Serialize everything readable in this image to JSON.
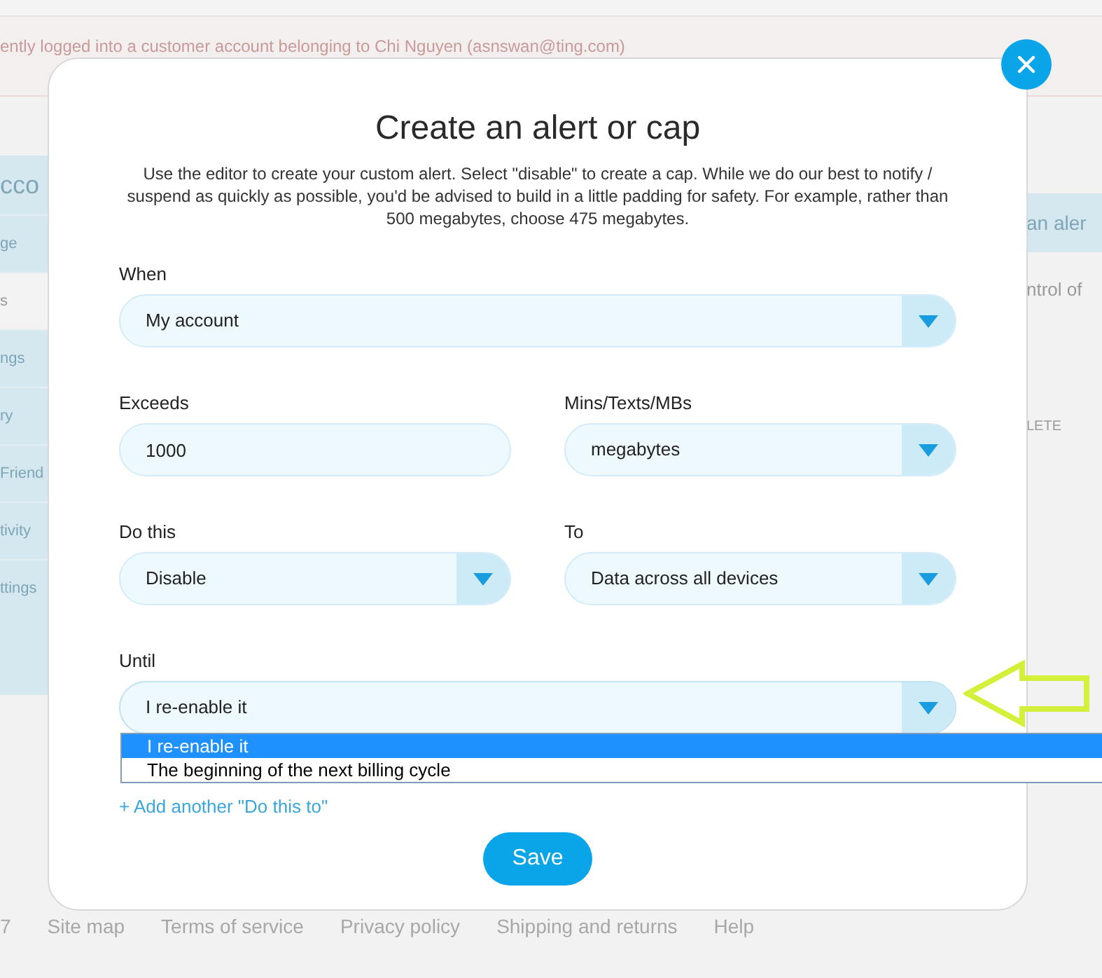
{
  "background": {
    "banner": "ently logged into a customer account belonging to Chi Nguyen (asnswan@ting.com)",
    "sidebar": {
      "heading": "cco",
      "items": [
        {
          "label": "ge",
          "selected": false
        },
        {
          "label": "s",
          "selected": true
        },
        {
          "label": "ngs",
          "selected": false
        },
        {
          "label": "ry",
          "selected": false
        },
        {
          "label": "Friend",
          "selected": false
        },
        {
          "label": "tivity",
          "selected": false
        },
        {
          "label": "ttings",
          "selected": false
        }
      ]
    },
    "right_panel": {
      "heading": "an aler",
      "text": "ntrol of",
      "column": "LETE"
    },
    "footer": [
      "7",
      "Site map",
      "Terms of service",
      "Privacy policy",
      "Shipping and returns",
      "Help"
    ]
  },
  "dialog": {
    "title": "Create an alert or cap",
    "description": "Use the editor to create your custom alert. Select \"disable\" to create a cap. While we do our best to notify / suspend as quickly as possible, you'd be advised to build in a little padding for safety. For example, rather than 500 megabytes, choose 475 megabytes.",
    "rows": [
      [
        {
          "label": "When",
          "kind": "select",
          "value": "My account"
        }
      ],
      [
        {
          "label": "Exceeds",
          "kind": "input",
          "value": "1000"
        },
        {
          "label": "Mins/Texts/MBs",
          "kind": "select",
          "value": "megabytes"
        }
      ],
      [
        {
          "label": "Do this",
          "kind": "select",
          "value": "Disable"
        },
        {
          "label": "To",
          "kind": "select",
          "value": "Data across all devices"
        }
      ],
      [
        {
          "label": "Until",
          "kind": "select",
          "value": "I re-enable it",
          "expanded": true,
          "options": [
            {
              "label": "I re-enable it",
              "selected": true
            },
            {
              "label": "The beginning of the next billing cycle",
              "selected": false
            }
          ]
        }
      ]
    ],
    "add_link": "+ Add another \"Do this to\"",
    "save_button": "Save"
  }
}
